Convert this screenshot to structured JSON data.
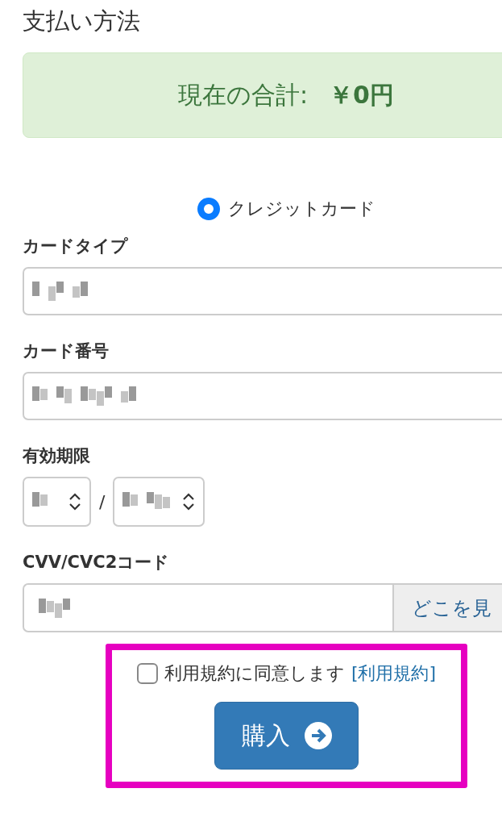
{
  "heading": "支払い方法",
  "total": {
    "label": "現在の合計:",
    "amount": "￥0円"
  },
  "payment_methods": [
    {
      "label": "クレジットカード",
      "selected": true
    }
  ],
  "fields": [
    {
      "kind": "text",
      "label": "カードタイプ"
    },
    {
      "kind": "text",
      "label": "カード番号"
    },
    {
      "kind": "expiry",
      "label": "有効期限",
      "separator": "/"
    },
    {
      "kind": "addon",
      "label": "CVV/CVC2コード",
      "addon": "どこを見"
    }
  ],
  "terms": {
    "text": "利用規約に同意します",
    "link": "[利用規約]",
    "checked": false
  },
  "submit": {
    "label": "購入"
  }
}
